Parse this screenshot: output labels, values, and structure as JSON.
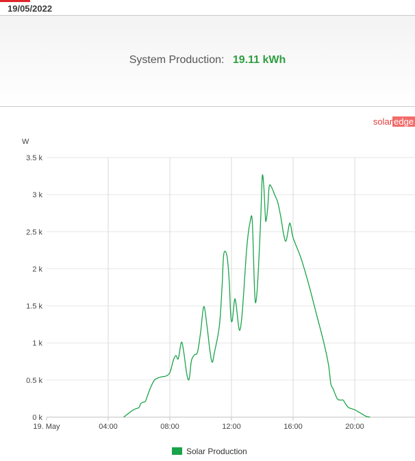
{
  "header": {
    "date": "19/05/2022"
  },
  "summary": {
    "label": "System Production:",
    "value": "19.11 kWh"
  },
  "logo": {
    "part1": "solar",
    "part2": "edge"
  },
  "colors": {
    "series": "#1aa34a",
    "value": "#2e9e3e",
    "brand": "#e23a3a"
  },
  "chart_data": {
    "type": "line",
    "ylabel": "W",
    "ylim": [
      0,
      3500
    ],
    "xlim_hours": [
      0,
      24
    ],
    "grid": true,
    "legend_position": "bottom-center",
    "y_ticks": [
      "0 k",
      "0.5 k",
      "1 k",
      "1.5 k",
      "2 k",
      "2.5 k",
      "3 k",
      "3.5 k"
    ],
    "x_ticks": [
      {
        "hour": 0,
        "label": "19. May"
      },
      {
        "hour": 4,
        "label": "04:00"
      },
      {
        "hour": 8,
        "label": "08:00"
      },
      {
        "hour": 12,
        "label": "12:00"
      },
      {
        "hour": 16,
        "label": "16:00"
      },
      {
        "hour": 20,
        "label": "20:00"
      }
    ],
    "series": [
      {
        "name": "Solar Production",
        "points": [
          [
            5.0,
            0
          ],
          [
            5.25,
            40
          ],
          [
            5.5,
            80
          ],
          [
            5.75,
            110
          ],
          [
            6.0,
            130
          ],
          [
            6.1,
            180
          ],
          [
            6.25,
            200
          ],
          [
            6.4,
            210
          ],
          [
            6.5,
            260
          ],
          [
            6.75,
            400
          ],
          [
            7.0,
            500
          ],
          [
            7.25,
            530
          ],
          [
            7.5,
            545
          ],
          [
            7.75,
            555
          ],
          [
            8.0,
            600
          ],
          [
            8.25,
            780
          ],
          [
            8.4,
            830
          ],
          [
            8.55,
            790
          ],
          [
            8.75,
            1010
          ],
          [
            8.9,
            880
          ],
          [
            9.1,
            580
          ],
          [
            9.25,
            510
          ],
          [
            9.4,
            760
          ],
          [
            9.6,
            840
          ],
          [
            9.8,
            880
          ],
          [
            10.0,
            1150
          ],
          [
            10.2,
            1490
          ],
          [
            10.4,
            1250
          ],
          [
            10.6,
            900
          ],
          [
            10.75,
            740
          ],
          [
            10.9,
            880
          ],
          [
            11.1,
            1080
          ],
          [
            11.25,
            1300
          ],
          [
            11.4,
            1800
          ],
          [
            11.5,
            2200
          ],
          [
            11.7,
            2180
          ],
          [
            11.85,
            1850
          ],
          [
            11.95,
            1380
          ],
          [
            12.05,
            1300
          ],
          [
            12.2,
            1580
          ],
          [
            12.3,
            1520
          ],
          [
            12.5,
            1180
          ],
          [
            12.65,
            1300
          ],
          [
            12.8,
            1700
          ],
          [
            13.0,
            2300
          ],
          [
            13.2,
            2620
          ],
          [
            13.35,
            2640
          ],
          [
            13.5,
            1700
          ],
          [
            13.6,
            1570
          ],
          [
            13.75,
            2000
          ],
          [
            13.9,
            2700
          ],
          [
            14.0,
            3250
          ],
          [
            14.1,
            3100
          ],
          [
            14.2,
            2700
          ],
          [
            14.25,
            2650
          ],
          [
            14.35,
            2820
          ],
          [
            14.45,
            3110
          ],
          [
            14.6,
            3100
          ],
          [
            14.8,
            3000
          ],
          [
            15.0,
            2900
          ],
          [
            15.2,
            2700
          ],
          [
            15.4,
            2450
          ],
          [
            15.55,
            2380
          ],
          [
            15.75,
            2600
          ],
          [
            15.85,
            2580
          ],
          [
            16.0,
            2420
          ],
          [
            16.5,
            2150
          ],
          [
            17.0,
            1800
          ],
          [
            17.5,
            1400
          ],
          [
            18.0,
            1000
          ],
          [
            18.3,
            700
          ],
          [
            18.45,
            450
          ],
          [
            18.6,
            380
          ],
          [
            18.75,
            300
          ],
          [
            18.9,
            240
          ],
          [
            19.1,
            230
          ],
          [
            19.25,
            230
          ],
          [
            19.4,
            180
          ],
          [
            19.6,
            130
          ],
          [
            20.0,
            100
          ],
          [
            20.25,
            70
          ],
          [
            20.5,
            40
          ],
          [
            20.75,
            10
          ],
          [
            21.0,
            0
          ]
        ]
      }
    ]
  }
}
